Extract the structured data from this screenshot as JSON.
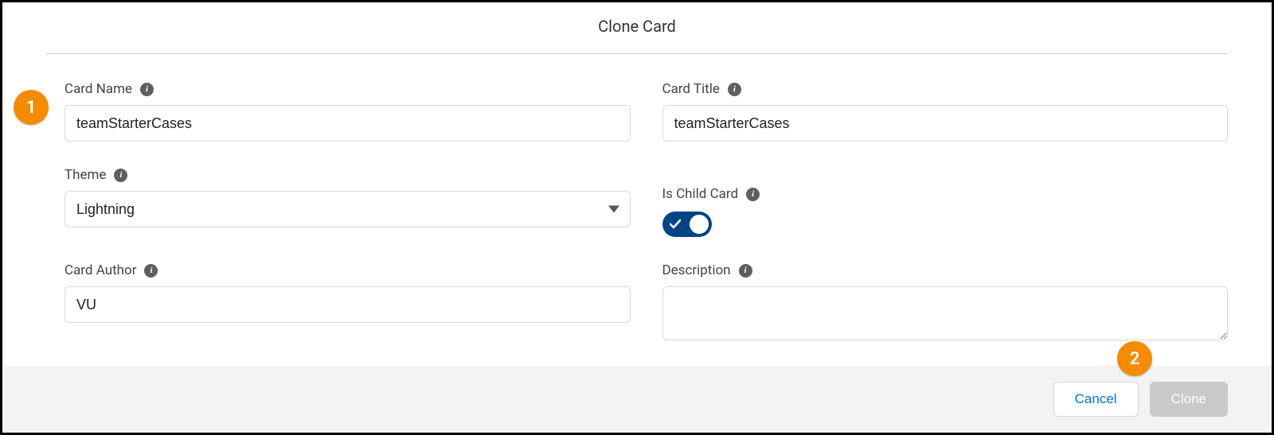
{
  "modal": {
    "title": "Clone Card"
  },
  "fields": {
    "cardName": {
      "label": "Card Name",
      "value": "teamStarterCases"
    },
    "cardTitle": {
      "label": "Card Title",
      "value": "teamStarterCases"
    },
    "theme": {
      "label": "Theme",
      "value": "Lightning"
    },
    "isChildCard": {
      "label": "Is Child Card",
      "checked": true
    },
    "cardAuthor": {
      "label": "Card Author",
      "value": "VU"
    },
    "description": {
      "label": "Description",
      "value": ""
    }
  },
  "buttons": {
    "cancel": "Cancel",
    "clone": "Clone"
  },
  "callouts": {
    "one": "1",
    "two": "2"
  }
}
